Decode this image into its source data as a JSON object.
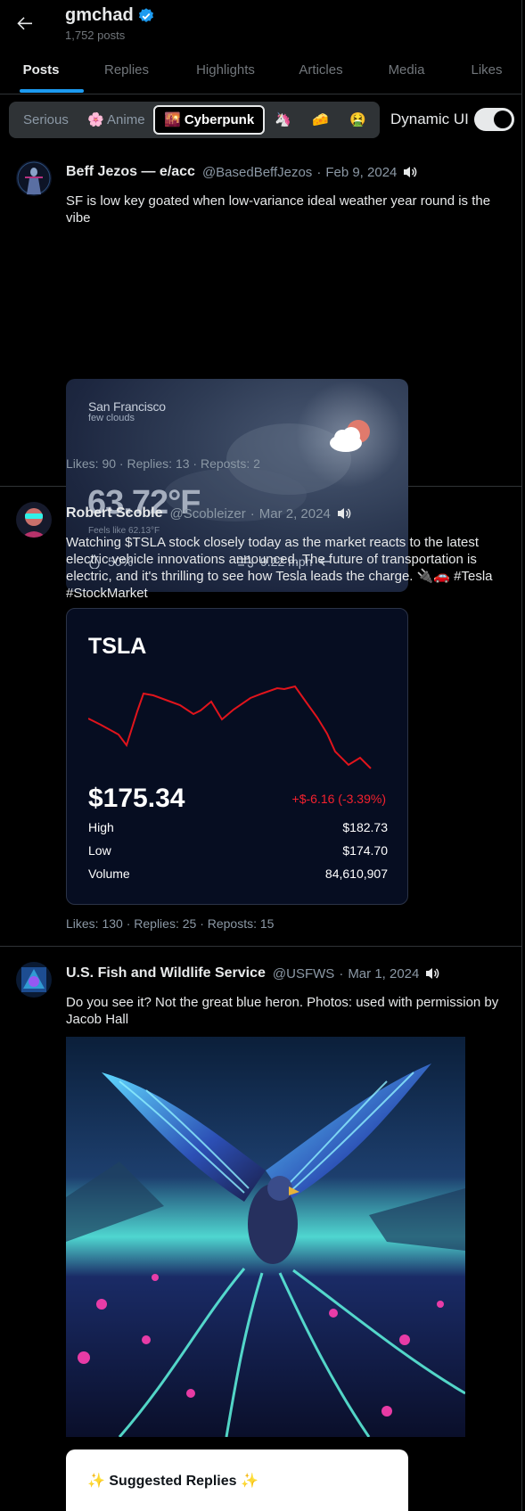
{
  "header": {
    "name": "gmchad",
    "post_count": "1,752 posts"
  },
  "tabs": [
    "Posts",
    "Replies",
    "Highlights",
    "Articles",
    "Media",
    "Likes"
  ],
  "themes": {
    "serious": "Serious",
    "anime": "🌸 Anime",
    "cyberpunk": "🌇 Cyberpunk",
    "unicorn": "🦄",
    "cheese": "🧀",
    "sick": "🤮"
  },
  "dynamic_ui": {
    "label": "Dynamic UI",
    "on": true
  },
  "posts": [
    {
      "name": "Beff Jezos — e/acc",
      "handle": "@BasedBeffJezos",
      "dot": "·",
      "date": "Feb 9, 2024",
      "text": "SF is low key goated when low-variance ideal weather year round is the vibe",
      "weather": {
        "city": "San Francisco",
        "desc": "few clouds",
        "temp": "63.72°F",
        "feels": "Feels like 62.13°F",
        "humidity": "50%",
        "wind": "9.22 mph"
      },
      "stats": "Likes: 90 · Replies: 13 · Reposts: 2"
    },
    {
      "name": "Robert Scoble",
      "handle": "@Scobleizer",
      "dot": "·",
      "date": "Mar 2, 2024",
      "text": "Watching $TSLA stock closely today as the market reacts to the latest electric vehicle innovations announced. The future of transportation is electric, and it's thrilling to see how Tesla leads the charge. 🔌🚗 #Tesla #StockMarket",
      "stock": {
        "ticker": "TSLA",
        "price": "$175.34",
        "change": "+$-6.16 (-3.39%)",
        "high_label": "High",
        "high": "$182.73",
        "low_label": "Low",
        "low": "$174.70",
        "volume_label": "Volume",
        "volume": "84,610,907",
        "line_color": "#e0141c"
      },
      "stats": "Likes: 130 · Replies: 25 · Reposts: 15"
    },
    {
      "name": "U.S. Fish and Wildlife Service",
      "handle": "@USFWS",
      "dot": "·",
      "date": "Mar 1, 2024",
      "text": "Do you see it? Not the great blue heron. Photos: used with permission by Jacob Hall",
      "suggest_title": "✨ Suggested Replies ✨"
    }
  ],
  "colors": {
    "accent": "#1d9bf0",
    "muted": "#71767b",
    "negative": "#f4212e"
  }
}
